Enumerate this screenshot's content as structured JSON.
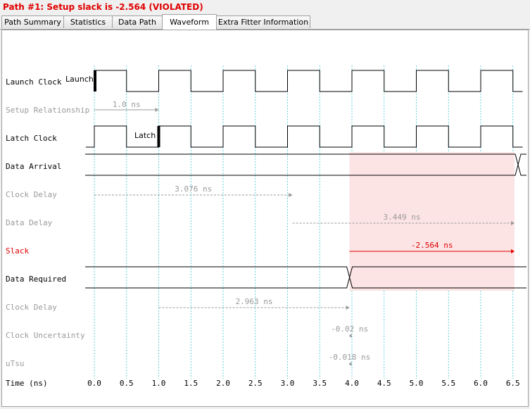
{
  "title": "Path #1: Setup slack is -2.564 (VIOLATED)",
  "tabs": [
    {
      "label": "Path Summary",
      "active": false
    },
    {
      "label": "Statistics",
      "active": false
    },
    {
      "label": "Data Path",
      "active": false
    },
    {
      "label": "Waveform",
      "active": true
    },
    {
      "label": "Extra Fitter Information",
      "active": false
    }
  ],
  "rows": {
    "launch_clock": "Launch Clock",
    "setup_relationship": "Setup Relationship",
    "latch_clock": "Latch Clock",
    "data_arrival": "Data Arrival",
    "clock_delay_1": "Clock Delay",
    "data_delay": "Data Delay",
    "slack": "Slack",
    "data_required": "Data Required",
    "clock_delay_2": "Clock Delay",
    "clock_uncertainty": "Clock Uncertainty",
    "utsu": "uTsu",
    "time_axis": "Time (ns)"
  },
  "markers": {
    "launch": "Launch",
    "latch": "Latch"
  },
  "annotations": {
    "setup_relationship": {
      "label": "1.0 ns",
      "start": 0.0,
      "end": 1.0
    },
    "clock_delay_1": {
      "label": "3.076 ns",
      "start": 0.0,
      "end": 3.076
    },
    "data_delay": {
      "label": "3.449 ns",
      "start": 3.076,
      "end": 6.525
    },
    "slack": {
      "label": "-2.564 ns",
      "start": 3.961,
      "end": 6.525
    },
    "clock_delay_2": {
      "label": "2.963 ns",
      "start": 1.0,
      "end": 3.963
    },
    "clock_uncertainty": {
      "label": "-0.02 ns",
      "at": 3.963
    },
    "utsu": {
      "label": "-0.018 ns",
      "at": 3.961
    }
  },
  "clock_period": 1.0,
  "time_ticks": [
    "0.0",
    "0.5",
    "1.0",
    "1.5",
    "2.0",
    "2.5",
    "3.0",
    "3.5",
    "4.0",
    "4.5",
    "5.0",
    "5.5",
    "6.0",
    "6.5"
  ],
  "colors": {
    "title": "#e00000",
    "slack": "#e00000",
    "gridline": "#3ec6d6",
    "dim_text": "#9a9a9a",
    "violation_fill": "#fde4e4"
  }
}
